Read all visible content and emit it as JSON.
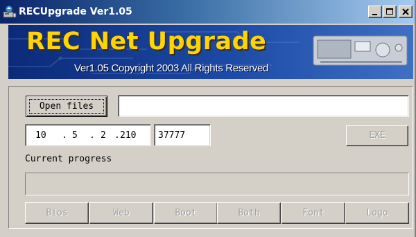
{
  "window": {
    "title": "RECUpgrade Ver1.05",
    "controls": {
      "minimize": "_",
      "maximize": "□",
      "close": "X"
    }
  },
  "banner": {
    "title": "REC Net Upgrade",
    "copyright": "Ver1.05 Copyright 2003 All Rights Reserved"
  },
  "form": {
    "open_files_label": "Open files",
    "file_path_value": "",
    "ip": {
      "octet1": "10",
      "octet2": "5",
      "octet3": "2",
      "octet4": "210",
      "dot": "."
    },
    "port_value": "37777",
    "exe_label": "EXE",
    "progress_label": "Current progress",
    "progress_value": 0
  },
  "actions": [
    "Bios",
    "Web",
    "Boot",
    "Both",
    "Font",
    "Logo"
  ],
  "colors": {
    "face": "#d4d0c8",
    "title_start": "#0a246a",
    "title_end": "#a6caf0",
    "banner_title": "#ffd400",
    "disabled_text": "#a0a0a0"
  }
}
